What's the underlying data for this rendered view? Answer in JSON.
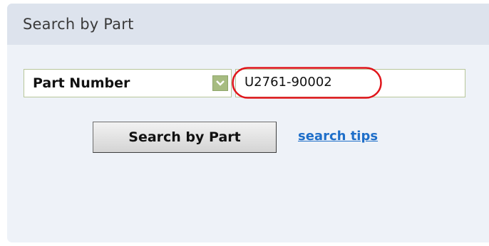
{
  "panel": {
    "title": "Search by Part"
  },
  "search": {
    "type_select": {
      "selected": "Part Number",
      "icon": "chevron-down-icon"
    },
    "part_input": {
      "value": "U2761-90002"
    },
    "submit_label": "Search by Part",
    "tips_label": "search tips"
  },
  "colors": {
    "panel_bg": "#eef2f8",
    "header_bg": "#dde3ed",
    "field_border": "#b7c69a",
    "dropdown_arrow_bg": "#a7bc81",
    "link": "#1f6fc9",
    "highlight": "#e0151b"
  }
}
